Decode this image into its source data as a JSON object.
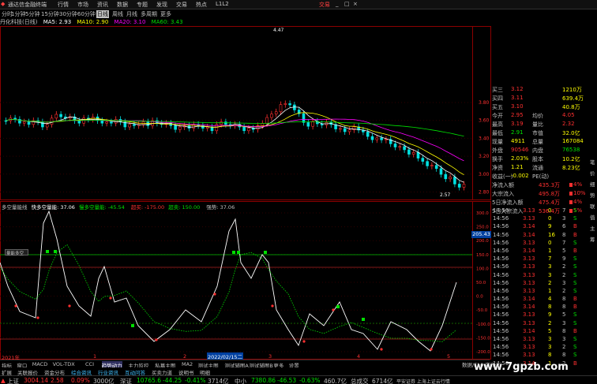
{
  "menu": {
    "app_title": "通达信金融终端",
    "items": [
      "行情",
      "市场",
      "资讯",
      "数据",
      "专题",
      "发现",
      "交易",
      "热点",
      "L1L2"
    ],
    "trade_label": "交易",
    "window_controls": [
      "_",
      "□",
      "×"
    ]
  },
  "periods": [
    "分时",
    "1分钟",
    "5分钟",
    "15分钟",
    "30分钟",
    "60分钟",
    "日线",
    "周线",
    "月线",
    "多周期",
    "更多"
  ],
  "periods_selected": "日线",
  "ma_legend": {
    "stock": "丹化科技(日线)",
    "ma5": "MA5: 2.93",
    "ma10": "MA10: 2.90",
    "ma20": "MA20: 3.10",
    "ma60": "MA60: 3.43"
  },
  "price_chart": {
    "high_label": "4.47",
    "low_label": "2.57",
    "y_ticks": [
      "3.80",
      "3.60",
      "3.40",
      "3.20",
      "3.00",
      "2.80"
    ]
  },
  "indicator_legend": {
    "name": "多空量能线",
    "item1": "快多空量能: 37.06",
    "item2": "慢多空量能: -45.54",
    "item3": "超买: -175.00",
    "item4": "超卖: 150.00",
    "item5": "强势: 37.06"
  },
  "indicator": {
    "y_ticks": [
      "300.0",
      "250.0",
      "200.0",
      "150.0",
      "100.0",
      "50.0",
      "0.0",
      "-50.0",
      "-100.0",
      "-150.0",
      "-200.0"
    ],
    "value_box": "205.43",
    "small_box": "量能多空",
    "date_start": "2021年",
    "date_cursor": "2022/02/15二",
    "axis_marks": [
      "1",
      "2",
      "3",
      "4",
      "5"
    ]
  },
  "quote": {
    "rows": [
      {
        "l": "买三",
        "v": "3.12",
        "r": "1210万",
        "vc": "#ff3030",
        "rc": "#ffff00"
      },
      {
        "l": "买四",
        "v": "3.11",
        "r": "639.4万",
        "vc": "#ff3030",
        "rc": "#ffff00"
      },
      {
        "l": "买五",
        "v": "3.10",
        "r": "40.8万",
        "vc": "#ff3030",
        "rc": "#ffff00"
      },
      {
        "l": "今开",
        "v": "2.95",
        "l2": "均价",
        "r": "4.05",
        "vc": "#ff3030",
        "rc": "#ff3030"
      },
      {
        "l": "最高",
        "v": "3.19",
        "l2": "量比",
        "r": "2.32",
        "vc": "#ff3030",
        "rc": "#ff3030"
      },
      {
        "l": "最低",
        "v": "2.91",
        "l2": "市值",
        "r": "32.0亿",
        "vc": "#00e000",
        "rc": "#ffff00"
      },
      {
        "l": "现量",
        "v": "4911",
        "l2": "总量",
        "r": "167084",
        "vc": "#ffff00",
        "rc": "#ffff00"
      },
      {
        "l": "外盘",
        "v": "90546",
        "l2": "内盘",
        "r": "76538",
        "vc": "#ff3030",
        "rc": "#00e000"
      },
      {
        "l": "换手",
        "v": "2.03%",
        "l2": "股本",
        "r": "10.2亿",
        "vc": "#ffff00",
        "rc": "#ffff00"
      },
      {
        "l": "净资",
        "v": "1.21",
        "l2": "流通",
        "r": "8.23亿",
        "vc": "#ffff00",
        "rc": "#ffff00"
      },
      {
        "l": "收益(一)",
        "v": "-0.002",
        "l2": "PE(动)",
        "r": "",
        "vc": "#ffff00",
        "rc": "#ffff00"
      }
    ],
    "flows": [
      {
        "l": "净流入额",
        "v": "435.3万",
        "p": "4%"
      },
      {
        "l": "大宗流入",
        "v": "495.8万",
        "p": "10%"
      },
      {
        "l": "5日净流入额",
        "v": "475.4万",
        "p": "4%"
      },
      {
        "l": "5日大宗流入",
        "v": "536.4万",
        "p": "5%"
      }
    ]
  },
  "ticks": [
    {
      "t": "14:56",
      "p": "3.13",
      "v": "0",
      "n": "7",
      "d": "S"
    },
    {
      "t": "14:56",
      "p": "3.13",
      "v": "0",
      "n": "3",
      "d": "S"
    },
    {
      "t": "14:56",
      "p": "3.14",
      "v": "9",
      "n": "6",
      "d": "B"
    },
    {
      "t": "14:56",
      "p": "3.14",
      "v": "16",
      "n": "8",
      "d": "B"
    },
    {
      "t": "14:56",
      "p": "3.13",
      "v": "0",
      "n": "7",
      "d": "S"
    },
    {
      "t": "14:56",
      "p": "3.14",
      "v": "1",
      "n": "5",
      "d": "B"
    },
    {
      "t": "14:56",
      "p": "3.13",
      "v": "7",
      "n": "9",
      "d": "S"
    },
    {
      "t": "14:56",
      "p": "3.13",
      "v": "3",
      "n": "2",
      "d": "S"
    },
    {
      "t": "14:56",
      "p": "3.13",
      "v": "3",
      "n": "2",
      "d": "S"
    },
    {
      "t": "14:56",
      "p": "3.13",
      "v": "2",
      "n": "3",
      "d": "S"
    },
    {
      "t": "14:56",
      "p": "3.13",
      "v": "1",
      "n": "2",
      "d": "S"
    },
    {
      "t": "14:56",
      "p": "3.14",
      "v": "4",
      "n": "8",
      "d": "B"
    },
    {
      "t": "14:56",
      "p": "3.14",
      "v": "8",
      "n": "8",
      "d": "B"
    },
    {
      "t": "14:56",
      "p": "3.13",
      "v": "9",
      "n": "5",
      "d": "S"
    },
    {
      "t": "14:56",
      "p": "3.13",
      "v": "2",
      "n": "3",
      "d": "S"
    },
    {
      "t": "14:56",
      "p": "3.14",
      "v": "5",
      "n": "8",
      "d": "B"
    },
    {
      "t": "14:56",
      "p": "3.13",
      "v": "3",
      "n": "3",
      "d": "S"
    },
    {
      "t": "14:56",
      "p": "3.13",
      "v": "3",
      "n": "2",
      "d": "S"
    },
    {
      "t": "14:56",
      "p": "3.13",
      "v": "8",
      "n": "8",
      "d": "S"
    },
    {
      "t": "14:56",
      "p": "3.14",
      "v": "1",
      "n": "2",
      "d": "B"
    }
  ],
  "bottom_tabs": [
    "指标",
    "窗口",
    "MACD",
    "VOL-TDX",
    "CCI",
    "趋势动力",
    "主力监控",
    "私募主图",
    "MA2",
    "测试主图",
    "测试辅图A",
    "测试辅图B",
    "更多",
    "设置"
  ],
  "toolbar2": [
    "扩展",
    "关联报价",
    "资金分布",
    "综合资讯",
    "行业资讯",
    "互动问答",
    "买卖力道",
    "说明书",
    "明细"
  ],
  "right_tabs": [
    "笔",
    "价",
    "细",
    "势",
    "联",
    "值",
    "主",
    "筹"
  ],
  "status": {
    "sh_label": "上证",
    "sh_val": "3004.14",
    "sh_chg": "2.58",
    "sh_pct": "0.09%",
    "sh_amt": "3000亿",
    "sz_label": "深证",
    "sz_val": "10765.6",
    "sz_chg": "-44.25",
    "sz_pct": "-0.41%",
    "sz_amt": "3714亿",
    "zx_label": "中小",
    "zx_val": "7380.86",
    "zx_chg": "-46.53",
    "zx_pct": "-0.63%",
    "zx_amt": "460.7亿",
    "total_label": "总成交",
    "total_val": "6714亿",
    "news": "平安证券 上海上证云行情"
  },
  "watermark": "www.7gpzb.com",
  "f10_label": "数据/F10 资讯",
  "colors": {
    "up": "#ff3030",
    "down": "#00e0e0",
    "ma5": "#ffffff",
    "ma10": "#ffff00",
    "ma20": "#ff00ff",
    "ma60": "#00e000",
    "grid_red": "#8b0000"
  }
}
